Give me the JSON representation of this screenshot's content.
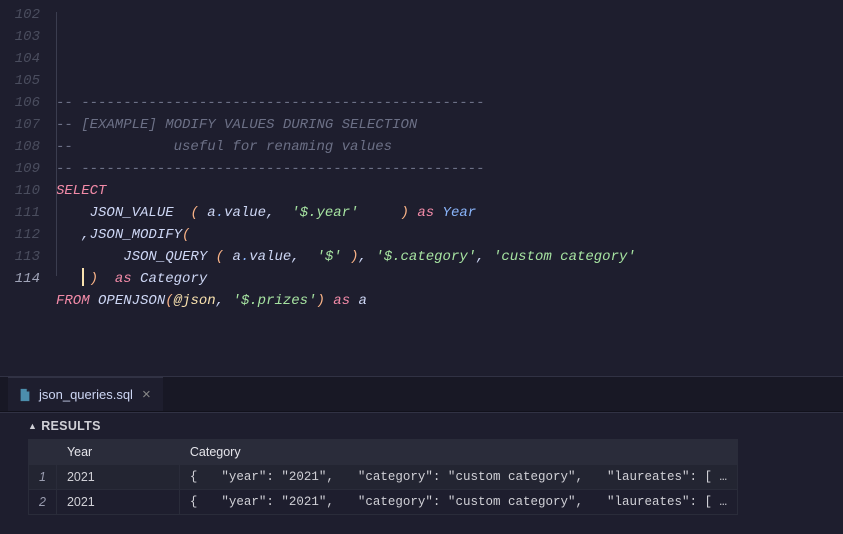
{
  "editor": {
    "lines": [
      {
        "num": 102,
        "tokens": []
      },
      {
        "num": 103,
        "tokens": [
          {
            "cls": "c-comment",
            "t": "-- ------------------------------------------------"
          }
        ]
      },
      {
        "num": 104,
        "tokens": [
          {
            "cls": "c-comment",
            "t": "-- [EXAMPLE] MODIFY VALUES DURING SELECTION"
          }
        ]
      },
      {
        "num": 105,
        "tokens": [
          {
            "cls": "c-comment",
            "t": "--            useful for renaming values"
          }
        ]
      },
      {
        "num": 106,
        "tokens": [
          {
            "cls": "c-comment",
            "t": "-- ------------------------------------------------"
          }
        ]
      },
      {
        "num": 107,
        "tokens": [
          {
            "cls": "c-keyword",
            "t": "SELECT"
          }
        ]
      },
      {
        "num": 108,
        "tokens": [
          {
            "cls": "",
            "t": "    "
          },
          {
            "cls": "c-func",
            "t": "JSON_VALUE  "
          },
          {
            "cls": "c-paren",
            "t": "("
          },
          {
            "cls": "c-ident",
            "t": " a"
          },
          {
            "cls": "c-dot",
            "t": "."
          },
          {
            "cls": "c-ident",
            "t": "value,  "
          },
          {
            "cls": "c-string",
            "t": "'$.year'"
          },
          {
            "cls": "",
            "t": "     "
          },
          {
            "cls": "c-paren",
            "t": ")"
          },
          {
            "cls": "",
            "t": " "
          },
          {
            "cls": "c-as",
            "t": "as"
          },
          {
            "cls": "",
            "t": " "
          },
          {
            "cls": "c-alias",
            "t": "Year"
          }
        ]
      },
      {
        "num": 109,
        "tokens": [
          {
            "cls": "",
            "t": "   ,"
          },
          {
            "cls": "c-func",
            "t": "JSON_MODIFY"
          },
          {
            "cls": "c-paren",
            "t": "("
          }
        ]
      },
      {
        "num": 110,
        "tokens": [
          {
            "cls": "",
            "t": "        "
          },
          {
            "cls": "c-func",
            "t": "JSON_QUERY "
          },
          {
            "cls": "c-paren",
            "t": "("
          },
          {
            "cls": "c-ident",
            "t": " a"
          },
          {
            "cls": "c-dot",
            "t": "."
          },
          {
            "cls": "c-ident",
            "t": "value,  "
          },
          {
            "cls": "c-string",
            "t": "'$'"
          },
          {
            "cls": "",
            "t": " "
          },
          {
            "cls": "c-paren",
            "t": ")"
          },
          {
            "cls": "c-ident",
            "t": ", "
          },
          {
            "cls": "c-string",
            "t": "'$.category'"
          },
          {
            "cls": "c-ident",
            "t": ", "
          },
          {
            "cls": "c-string",
            "t": "'custom category'"
          }
        ]
      },
      {
        "num": 111,
        "tokens": [
          {
            "cls": "",
            "t": "    "
          },
          {
            "cls": "c-paren",
            "t": ")"
          },
          {
            "cls": "",
            "t": "  "
          },
          {
            "cls": "c-as",
            "t": "as"
          },
          {
            "cls": "",
            "t": " "
          },
          {
            "cls": "c-aliaswhite",
            "t": "Category"
          }
        ]
      },
      {
        "num": 112,
        "tokens": [
          {
            "cls": "c-keyword",
            "t": "FROM"
          },
          {
            "cls": "",
            "t": " "
          },
          {
            "cls": "c-func",
            "t": "OPENJSON"
          },
          {
            "cls": "c-paren",
            "t": "("
          },
          {
            "cls": "c-at",
            "t": "@json"
          },
          {
            "cls": "c-ident",
            "t": ", "
          },
          {
            "cls": "c-string",
            "t": "'$.prizes'"
          },
          {
            "cls": "c-paren",
            "t": ")"
          },
          {
            "cls": "",
            "t": " "
          },
          {
            "cls": "c-as",
            "t": "as"
          },
          {
            "cls": "",
            "t": " "
          },
          {
            "cls": "c-aliaswhite",
            "t": "a"
          }
        ]
      },
      {
        "num": 113,
        "tokens": []
      },
      {
        "num": 114,
        "current": true,
        "tokens": []
      }
    ]
  },
  "tab": {
    "filename": "json_queries.sql"
  },
  "results": {
    "label": "RESULTS",
    "columns": [
      "Year",
      "Category"
    ],
    "rows": [
      {
        "n": 1,
        "year": "2021",
        "category_parts": [
          "{",
          "\"year\": \"2021\",",
          "\"category\": \"custom category\",",
          "\"laureates\": [ …"
        ]
      },
      {
        "n": 2,
        "year": "2021",
        "category_parts": [
          "{",
          "\"year\": \"2021\",",
          "\"category\": \"custom category\",",
          "\"laureates\": [ …"
        ]
      }
    ]
  }
}
